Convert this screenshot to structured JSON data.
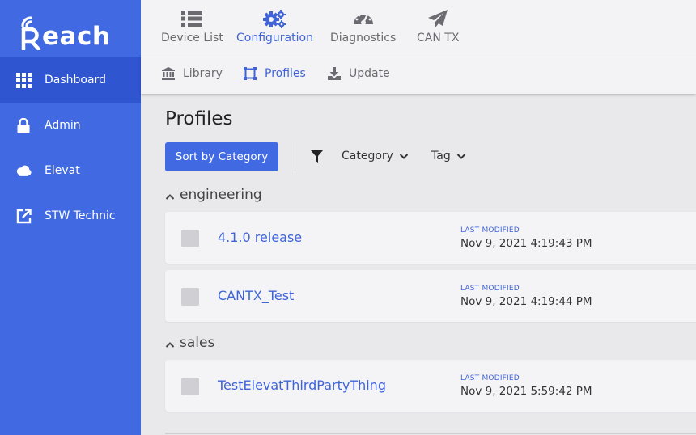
{
  "brand": {
    "name": "Reach",
    "logo_wordmark": "each",
    "logo_initial": "R"
  },
  "sidebar": {
    "items": [
      {
        "label": "Dashboard",
        "icon": "grid-icon",
        "active": true
      },
      {
        "label": "Admin",
        "icon": "lock-icon",
        "active": false
      },
      {
        "label": "Elevat",
        "icon": "cloud-icon",
        "active": false
      },
      {
        "label": "STW Technic",
        "icon": "external-link-icon",
        "active": false
      }
    ]
  },
  "top_tabs": [
    {
      "label": "Device List",
      "icon": "list-icon",
      "active": false
    },
    {
      "label": "Configuration",
      "icon": "gears-icon",
      "active": true
    },
    {
      "label": "Diagnostics",
      "icon": "gauge-icon",
      "active": false
    },
    {
      "label": "CAN TX",
      "icon": "paper-plane-icon",
      "active": false
    }
  ],
  "sub_tabs": [
    {
      "label": "Library",
      "icon": "bank-icon",
      "active": false
    },
    {
      "label": "Profiles",
      "icon": "profile-frame-icon",
      "active": true
    },
    {
      "label": "Update",
      "icon": "download-icon",
      "active": false
    }
  ],
  "main": {
    "title": "Profiles",
    "sort_button": "Sort by Category",
    "filters": [
      {
        "label": "Category"
      },
      {
        "label": "Tag"
      }
    ],
    "groups": [
      {
        "name": "engineering",
        "items": [
          {
            "name": "4.1.0 release",
            "meta_label": "LAST MODIFIED",
            "modified": "Nov 9, 2021 4:19:43 PM"
          },
          {
            "name": "CANTX_Test",
            "meta_label": "LAST MODIFIED",
            "modified": "Nov 9, 2021 4:19:44 PM"
          }
        ]
      },
      {
        "name": "sales",
        "items": [
          {
            "name": "TestElevatThirdPartyThing",
            "meta_label": "LAST MODIFIED",
            "modified": "Nov 9, 2021 5:59:42 PM"
          }
        ]
      }
    ]
  },
  "colors": {
    "accent": "#4169e1",
    "sidebar_active": "#2f55d0",
    "link": "#3f64d8",
    "background": "#e9e9ec"
  }
}
